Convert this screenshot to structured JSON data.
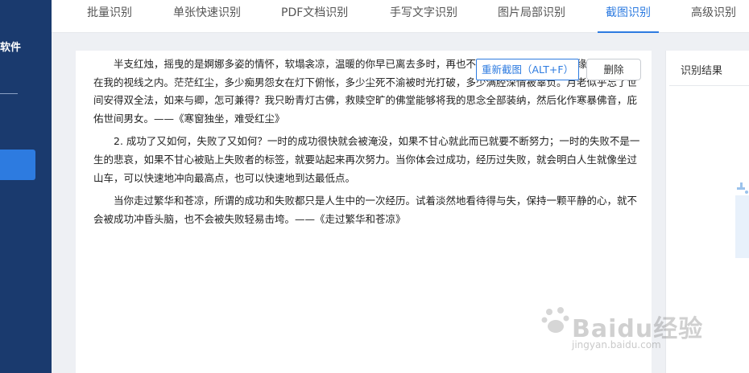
{
  "sidebar": {
    "label": "软件"
  },
  "tabs": [
    {
      "label": "批量识别"
    },
    {
      "label": "单张快速识别"
    },
    {
      "label": "PDF文档识别"
    },
    {
      "label": "手写文字识别"
    },
    {
      "label": "图片局部识别"
    },
    {
      "label": "截图识别",
      "active": true
    },
    {
      "label": "高级识别"
    }
  ],
  "document": {
    "paragraphs": [
      "半支红烛，摇曳的是婀娜多姿的情怀，软塌衾凉，温暖的你早已离去多时，再也不会出现，可是忘亲情深缘浅，你已不在我的视线之内。茫茫红尘，多少痴男怨女在灯下俯怅，多少尘死不渝被时光打破，多少满腔深情被辜负。月老似乎忘了世间安得双全法，如来与卿，怎可兼得？我只盼青灯古佛，救赎空旷的佛堂能够将我的思念全部装纳，然后化作寒暴佛音，庇佑世间男女。——《寒窗独坐，难受红尘》",
      "2. 成功了又如何，失败了又如何？一时的成功很快就会被淹没，如果不甘心就此而已就要不断努力；一时的失败不是一生的悲哀，如果不甘心被贴上失败者的标签，就要站起来再次努力。当你体会过成功，经历过失败，就会明白人生就像坐过山车，可以快速地冲向最高点，也可以快速地到达最低点。",
      "当你走过繁华和苍凉，所谓的成功和失败都只是人生中的一次经历。试着淡然地看待得与失，保持一颗平静的心，就不会被成功冲昏头脑，也不会被失败轻易击垮。——《走过繁华和苍凉》"
    ]
  },
  "buttons": {
    "recapture": "重新截图（ALT+F）",
    "delete": "删除"
  },
  "result": {
    "title": "识别结果"
  },
  "watermark": {
    "logo": "Baidu经验",
    "url": "jingyan.baidu.com"
  }
}
